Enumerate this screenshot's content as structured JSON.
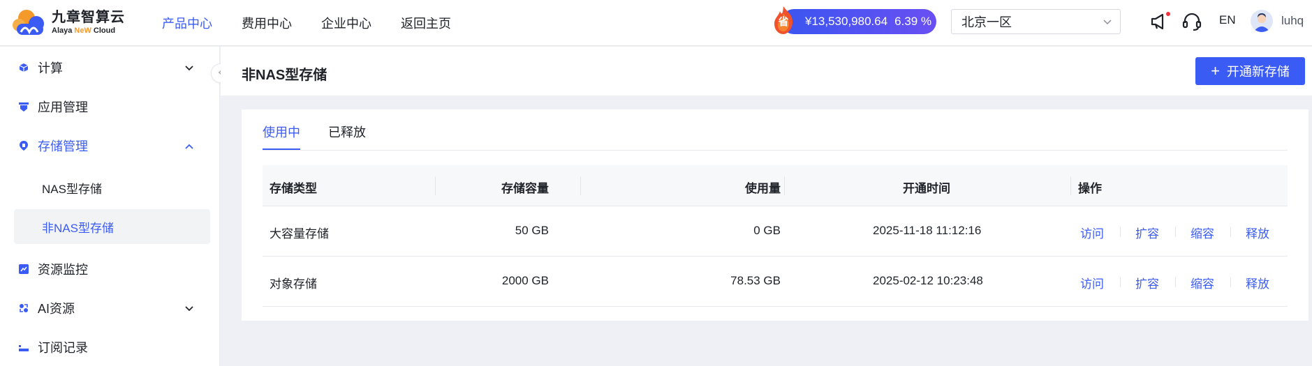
{
  "brand": {
    "name_cn": "九章智算云",
    "name_en_prefix": "Alaya ",
    "name_en_accent": "NeW",
    "name_en_suffix": " Cloud",
    "accent_color": "#3b5bf5"
  },
  "top_nav": [
    {
      "label": "产品中心",
      "active": true
    },
    {
      "label": "费用中心",
      "active": false
    },
    {
      "label": "企业中心",
      "active": false
    },
    {
      "label": "返回主页",
      "active": false
    }
  ],
  "balance": {
    "badge": "省",
    "amount": "¥13,530,980.64",
    "percent": "6.39 %"
  },
  "region": {
    "selected": "北京一区"
  },
  "header_icons": [
    "megaphone-icon",
    "headset-icon"
  ],
  "language": "EN",
  "user": {
    "name": "luhq"
  },
  "sidebar": {
    "items": [
      {
        "label": "计算",
        "icon": "cube-icon",
        "expandable": true,
        "expanded": false
      },
      {
        "label": "应用管理",
        "icon": "app-icon",
        "expandable": false
      },
      {
        "label": "存储管理",
        "icon": "storage-icon",
        "expandable": true,
        "expanded": true,
        "children": [
          {
            "label": "NAS型存储",
            "active": false
          },
          {
            "label": "非NAS型存储",
            "active": true
          }
        ]
      },
      {
        "label": "资源监控",
        "icon": "monitor-icon",
        "expandable": false
      },
      {
        "label": "AI资源",
        "icon": "ai-resource-icon",
        "expandable": true,
        "expanded": false
      },
      {
        "label": "订阅记录",
        "icon": "subscription-icon",
        "expandable": false
      }
    ]
  },
  "page": {
    "title": "非NAS型存储",
    "create_button": "开通新存储"
  },
  "tabs": [
    {
      "label": "使用中",
      "active": true
    },
    {
      "label": "已释放",
      "active": false
    }
  ],
  "table": {
    "columns": [
      "存储类型",
      "存储容量",
      "使用量",
      "开通时间",
      "操作"
    ],
    "rows": [
      {
        "type": "大容量存储",
        "capacity": "50 GB",
        "usage": "0 GB",
        "opened_at": "2025-11-18 11:12:16",
        "actions": [
          "访问",
          "扩容",
          "缩容",
          "释放"
        ]
      },
      {
        "type": "对象存储",
        "capacity": "2000 GB",
        "usage": "78.53 GB",
        "opened_at": "2025-02-12 10:23:48",
        "actions": [
          "访问",
          "扩容",
          "缩容",
          "释放"
        ]
      }
    ]
  }
}
